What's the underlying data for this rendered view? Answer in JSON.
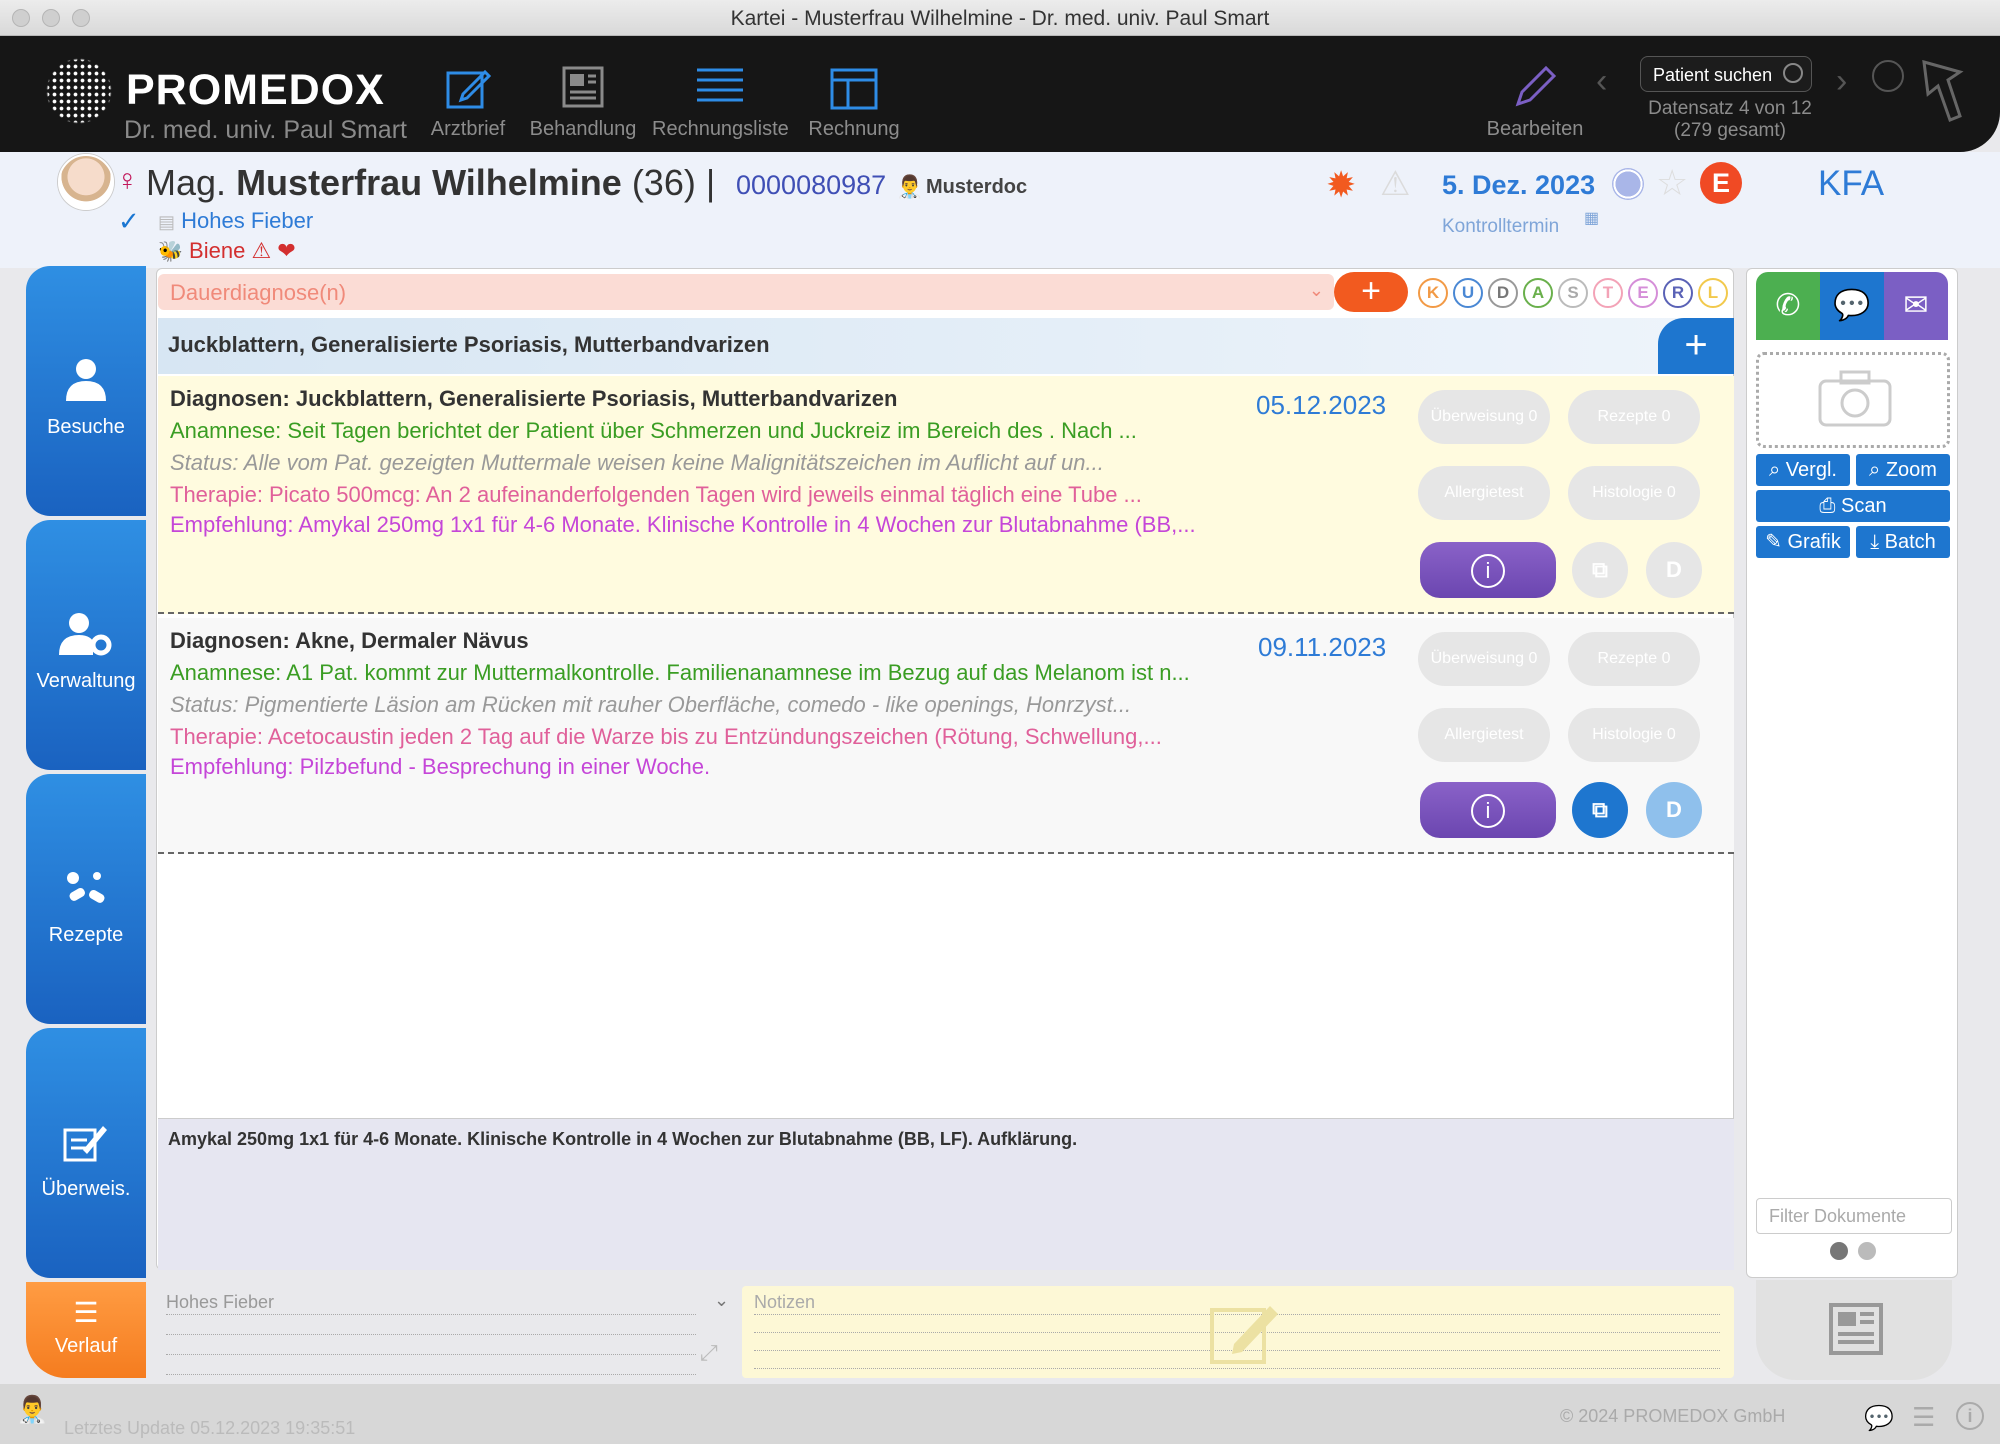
{
  "window": {
    "title": "Kartei - Musterfrau Wilhelmine - Dr. med. univ. Paul Smart"
  },
  "toolbar": {
    "brand": "PROMEDOX",
    "doctor": "Dr. med. univ. Paul Smart",
    "buttons": [
      {
        "label": "Arztbrief",
        "icon": "letter-edit-icon"
      },
      {
        "label": "Behandlung",
        "icon": "treatment-doc-icon"
      },
      {
        "label": "Rechnungsliste",
        "icon": "list-icon"
      },
      {
        "label": "Rechnung",
        "icon": "invoice-icon"
      }
    ],
    "edit_label": "Bearbeiten",
    "search_placeholder": "Patient suchen",
    "record_info_1": "Datensatz 4 von 12",
    "record_info_2": "(279 gesamt)"
  },
  "patient": {
    "title": "Mag.",
    "name": "Musterfrau Wilhelmine",
    "age": "(36)",
    "separator": "|",
    "id": "0000080987",
    "doctor": "Musterdoc",
    "hint": "Hohes Fieber",
    "allergy": "Biene",
    "appointment_date": "5. Dez. 2023",
    "appointment_label": "Kontrolltermin",
    "badge": "E",
    "insurance": "KFA"
  },
  "sidebar": {
    "items": [
      {
        "label": "Besuche"
      },
      {
        "label": "Verwaltung"
      },
      {
        "label": "Rezepte"
      },
      {
        "label": "Überweis."
      }
    ],
    "bottom_label": "Verlauf"
  },
  "main": {
    "dauer_placeholder": "Dauerdiagnose(n)",
    "category_letters": [
      "K",
      "U",
      "D",
      "A",
      "S",
      "T",
      "E",
      "R",
      "L"
    ],
    "diagnosis_header": "Juckblattern, Generalisierte Psoriasis, Mutterbandvarizen",
    "visits": [
      {
        "date": "05.12.2023",
        "diagnosen": "Diagnosen: Juckblattern, Generalisierte Psoriasis, Mutterbandvarizen",
        "anamnese": "Anamnese: Seit  Tagen berichtet der Patient über Schmerzen und Juckreiz im Bereich des  . Nach ...",
        "status": "Status: Alle vom Pat. gezeigten Muttermale weisen keine Malignitätszeichen im Auflicht auf un...",
        "therapie": "Therapie: Picato 500mcg: An 2 aufeinanderfolgenden Tagen wird jeweils einmal täglich eine Tube ...",
        "empfehlung": "Empfehlung: Amykal 250mg 1x1 für 4-6 Monate. Klinische Kontrolle in 4 Wochen zur Blutabnahme (BB,...",
        "ueberweisung": "Überweisung 0",
        "rezepte": "Rezepte 0",
        "allergietest": "Allergietest",
        "histologie": "Histologie 0",
        "info": "i",
        "d": "D"
      },
      {
        "date": "09.11.2023",
        "diagnosen": "Diagnosen: Akne, Dermaler Nävus",
        "anamnese": "Anamnese: A1 Pat. kommt zur Muttermalkontrolle. Familienanamnese im Bezug auf das Melanom ist n...",
        "status": "Status: Pigmentierte Läsion am Rücken mit rauher Oberfläche, comedo - like openings, Honrzyst...",
        "therapie": "Therapie: Acetocaustin jeden 2 Tag auf die Warze bis zu Entzündungszeichen (Rötung, Schwellung,...",
        "empfehlung": "Empfehlung: Pilzbefund - Besprechung in einer Woche.",
        "ueberweisung": "Überweisung 0",
        "rezepte": "Rezepte 0",
        "allergietest": "Allergietest",
        "histologie": "Histologie 0",
        "info": "i",
        "d": "D"
      }
    ],
    "note": "Amykal 250mg 1x1 für 4-6 Monate. Klinische Kontrolle in 4 Wochen zur Blutabnahme (BB, LF). Aufklärung."
  },
  "right": {
    "vergl": "Vergl.",
    "zoom": "Zoom",
    "scan": "Scan",
    "grafik": "Grafik",
    "batch": "Batch",
    "filter_placeholder": "Filter Dokumente"
  },
  "bottom": {
    "hint_value": "Hohes Fieber",
    "notes_placeholder": "Notizen"
  },
  "status": {
    "last_update": "Letztes Update  05.12.2023 19:35:51",
    "copyright": "© 2024 PROMEDOX GmbH"
  },
  "colors": {
    "brand_blue": "#1e76cf",
    "orange": "#f25a1f",
    "purple": "#6b46b0",
    "green": "#4caf50",
    "green_text": "#3a9d23",
    "pink_text": "#e0609a",
    "magenta_text": "#c546d8"
  }
}
